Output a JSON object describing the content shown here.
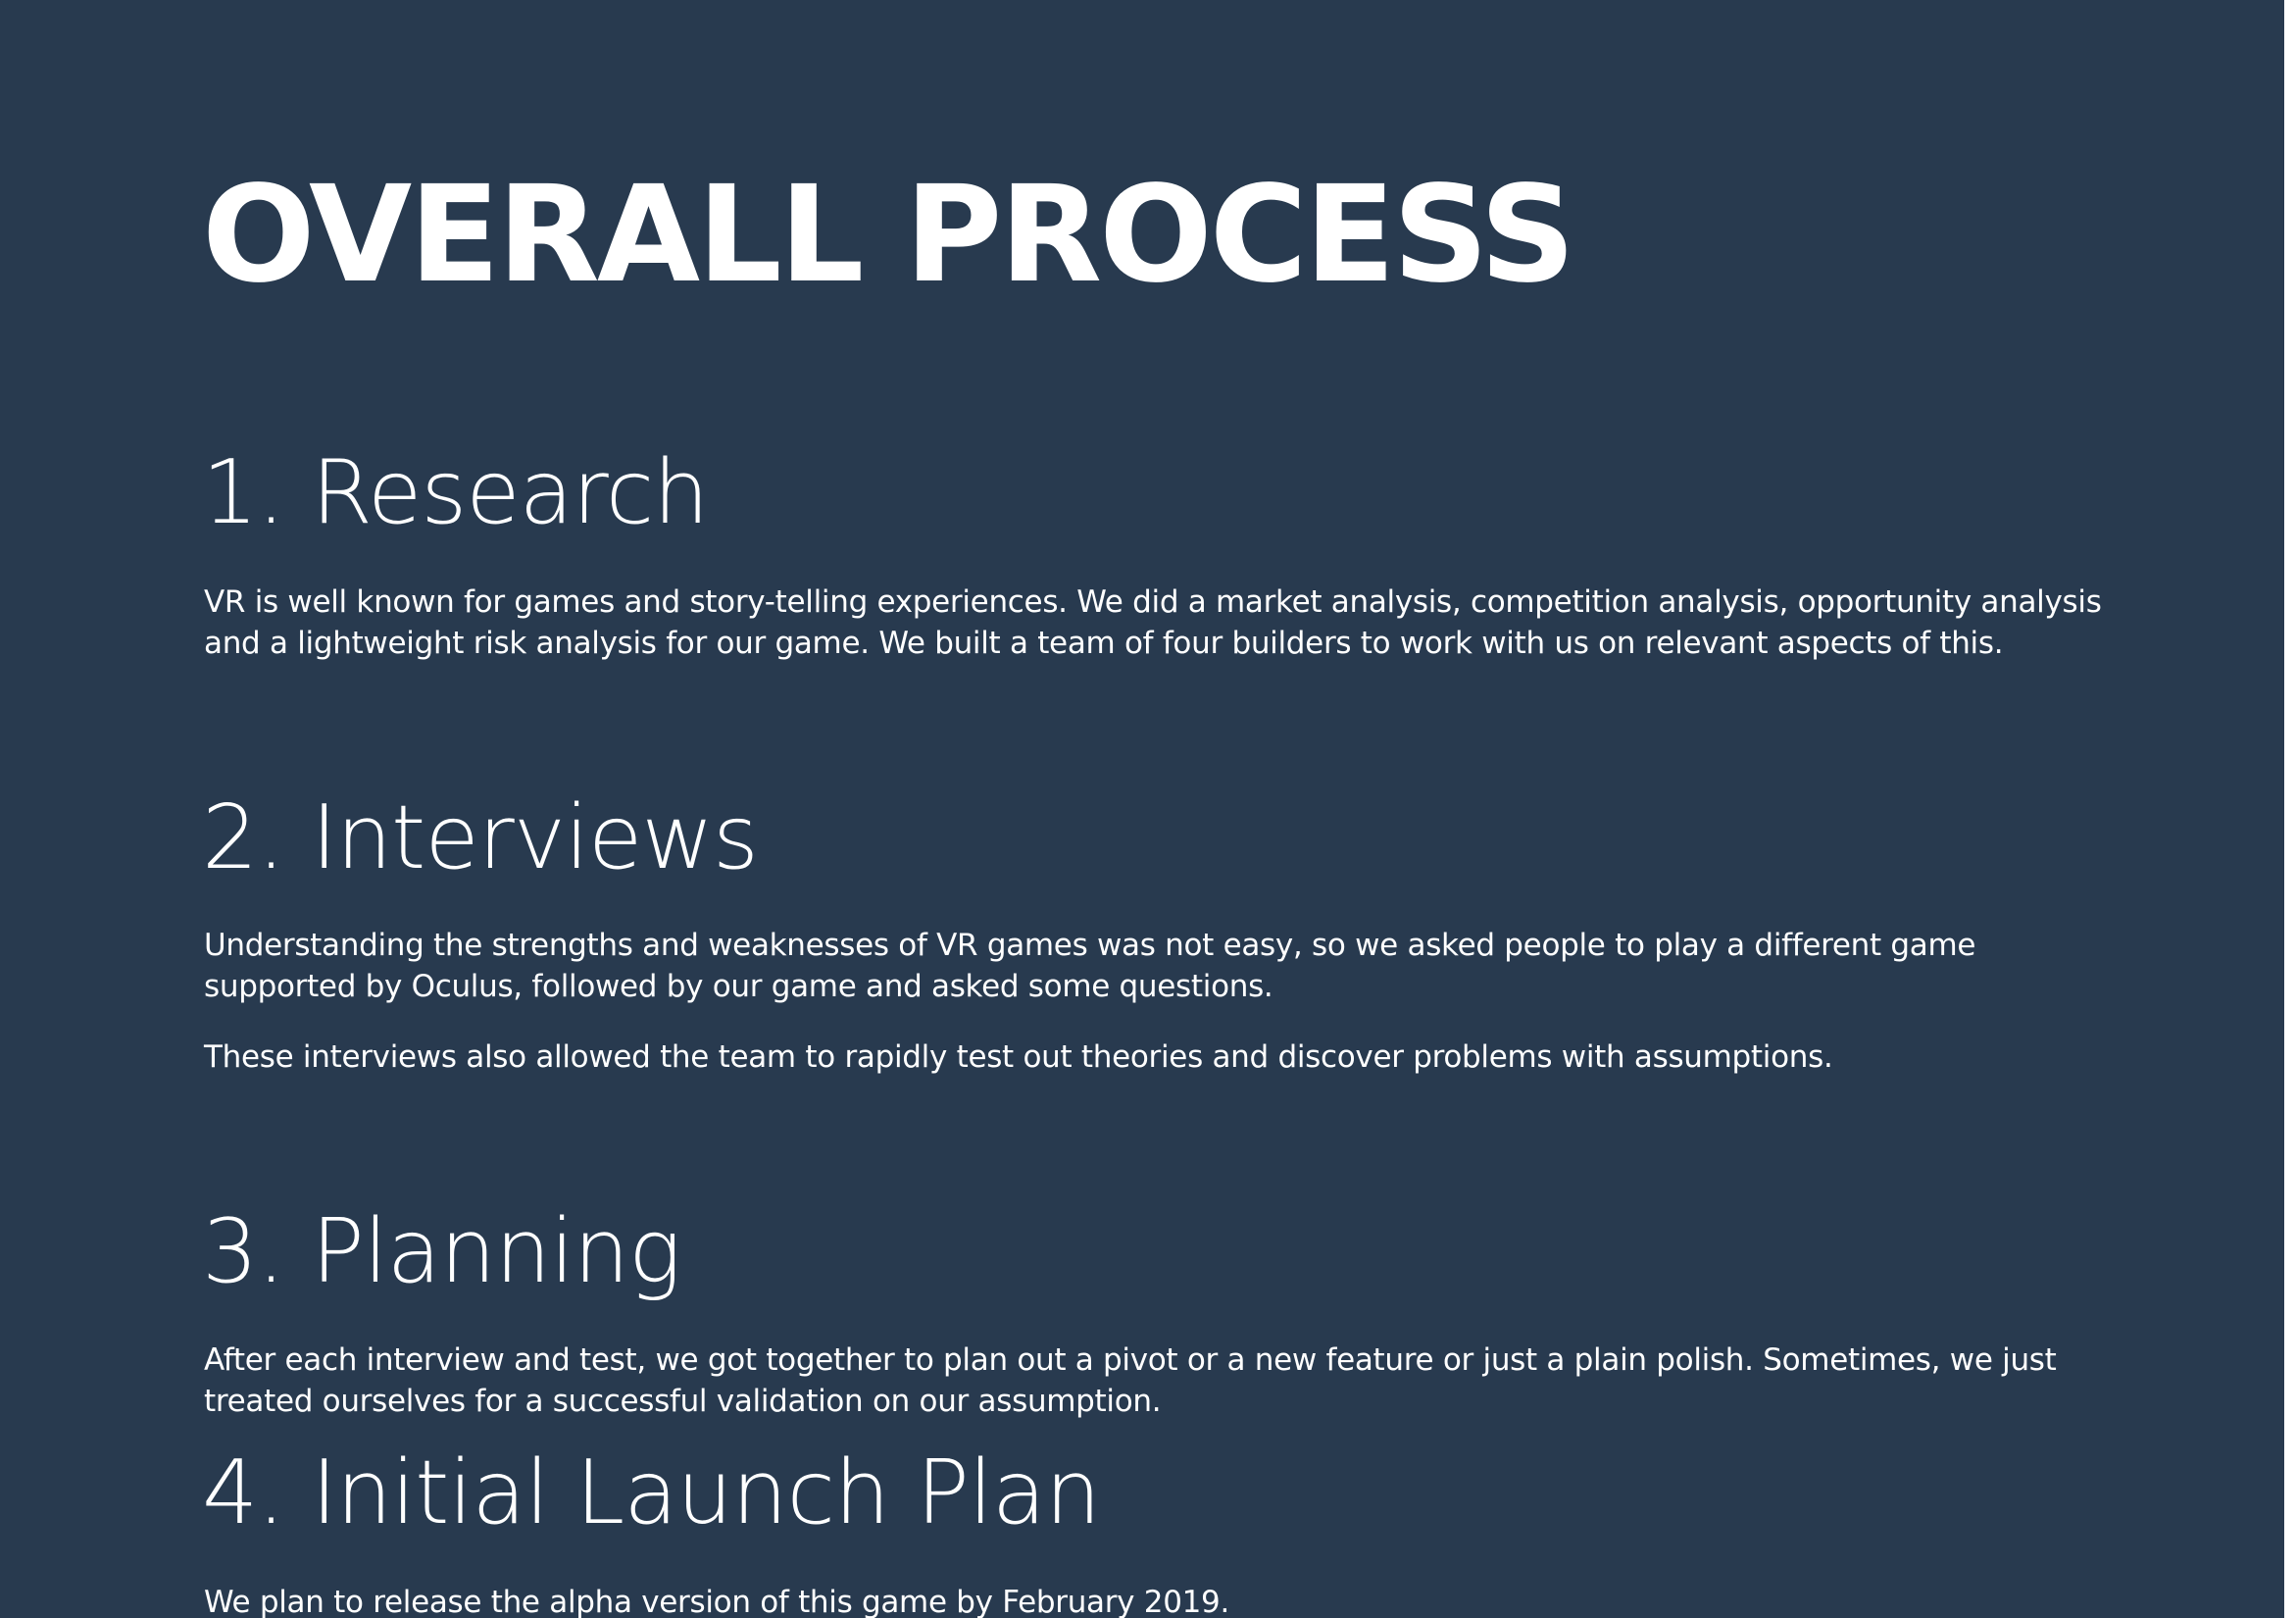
{
  "title": "OVERALL PROCESS",
  "sections": [
    {
      "heading": "1. Research",
      "paragraphs": [
        "VR is well known for games and story-telling experiences. We did a market analysis, competition analysis, opportunity analysis and a lightweight risk analysis for our game. We built a team of four builders to work with us on relevant aspects of this."
      ]
    },
    {
      "heading": "2. Interviews",
      "paragraphs": [
        "Understanding the strengths and weaknesses of VR games was not easy, so we asked people to play a different game supported by Oculus, followed by our game and asked some questions.",
        "These interviews also allowed the team to rapidly test out theories and discover problems with assumptions."
      ]
    },
    {
      "heading": "3. Planning",
      "paragraphs": [
        "After each interview and test, we got together to plan out a pivot or a new feature or just a plain polish. Sometimes, we just treated ourselves for a successful validation on our assumption."
      ]
    },
    {
      "heading": "4. Initial Launch Plan",
      "paragraphs": [
        "We plan to release the alpha version of this game by February 2019."
      ]
    }
  ],
  "colors": {
    "background": "#283a4f",
    "text": "#ffffff"
  }
}
